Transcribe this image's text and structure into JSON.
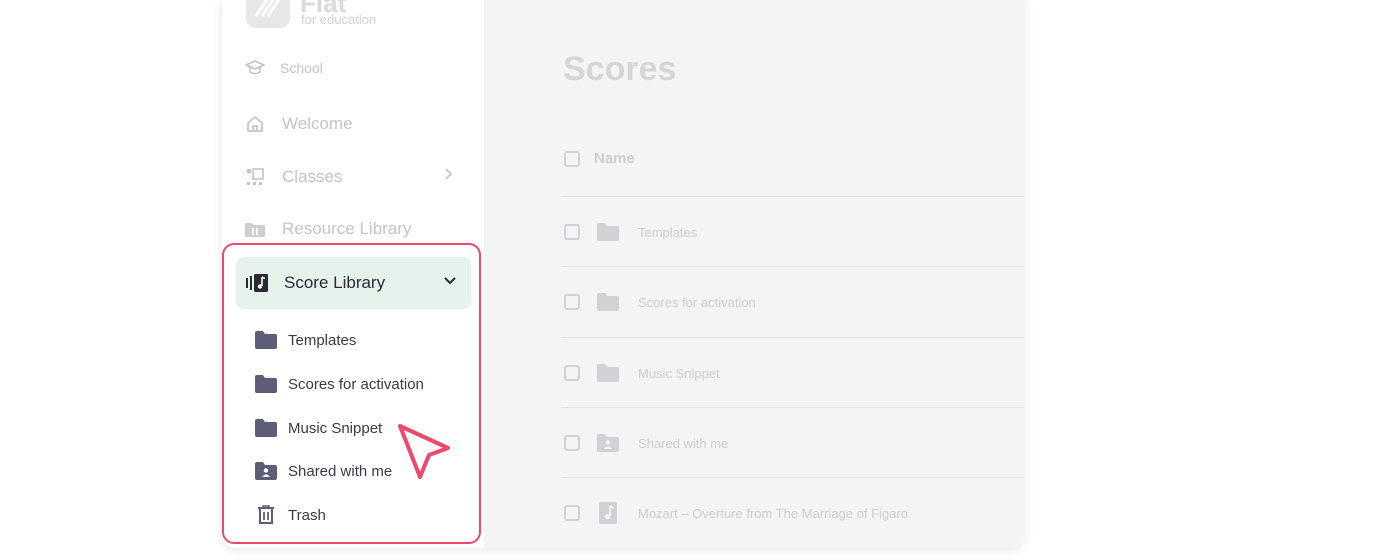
{
  "brand": {
    "name": "Flat",
    "subtitle": "for education"
  },
  "sidebar": {
    "school_label": "School",
    "items": [
      {
        "label": "Welcome",
        "icon": "home-icon"
      },
      {
        "label": "Classes",
        "icon": "classes-icon"
      },
      {
        "label": "Resource Library",
        "icon": "resource-library-icon"
      }
    ],
    "score_library": {
      "label": "Score Library",
      "icon": "score-library-icon",
      "expanded": true,
      "children": [
        {
          "label": "Templates",
          "icon": "folder-icon"
        },
        {
          "label": "Scores for activation",
          "icon": "folder-icon"
        },
        {
          "label": "Music Snippet",
          "icon": "folder-icon"
        },
        {
          "label": "Shared with me",
          "icon": "shared-folder-icon"
        },
        {
          "label": "Trash",
          "icon": "trash-icon"
        }
      ]
    }
  },
  "main": {
    "title": "Scores",
    "column_header": "Name",
    "rows": [
      {
        "label": "Templates",
        "icon": "folder-icon"
      },
      {
        "label": "Scores for activation",
        "icon": "folder-icon"
      },
      {
        "label": "Music Snippet",
        "icon": "folder-icon"
      },
      {
        "label": "Shared with me",
        "icon": "shared-folder-icon"
      },
      {
        "label": "Mozart – Overture from The Marriage of Figaro",
        "icon": "score-file-icon"
      }
    ]
  },
  "colors": {
    "highlight_border": "#f0476c",
    "active_bg": "#e6f2ec",
    "folder": "#5d5d78",
    "cursor": "#f0476c"
  }
}
